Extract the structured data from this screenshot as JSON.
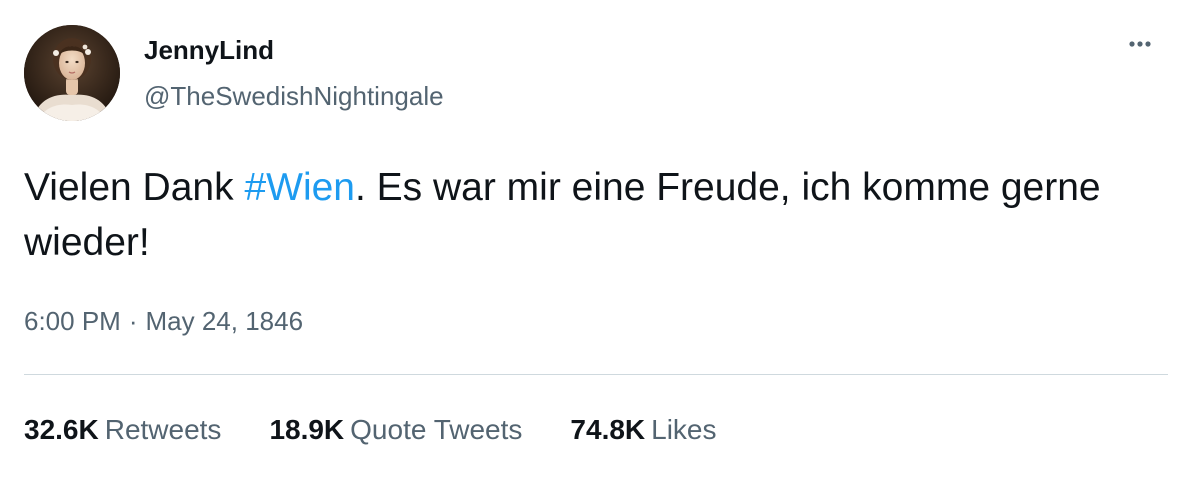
{
  "author": {
    "display_name": "JennyLind",
    "handle": "@TheSwedishNightingale",
    "avatar": "portrait-avatar"
  },
  "tweet": {
    "text_before": "Vielen Dank ",
    "hashtag": "#Wien",
    "text_after": ". Es war mir eine Freude, ich komme gerne wieder!",
    "time": "6:00 PM",
    "separator": "·",
    "date": "May 24, 1846"
  },
  "stats": {
    "retweets_count": "32.6K",
    "retweets_label": "Retweets",
    "quote_tweets_count": "18.9K",
    "quote_tweets_label": "Quote Tweets",
    "likes_count": "74.8K",
    "likes_label": "Likes"
  },
  "icons": {
    "more": "more-horizontal-icon"
  },
  "colors": {
    "text_primary": "#0f1419",
    "text_secondary": "#536471",
    "link": "#1d9bf0",
    "divider": "#cfd9de"
  }
}
